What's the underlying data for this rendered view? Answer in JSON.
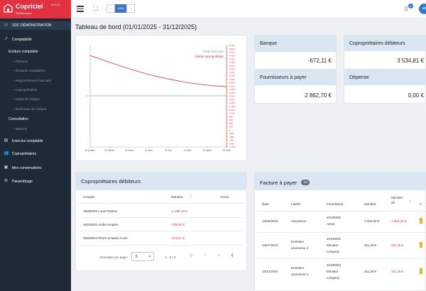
{
  "app": {
    "name": "Copriciel",
    "version": "v2.4.11",
    "subtitle": "Gestionnaire",
    "brand_color": "#e0323f"
  },
  "sidebar": {
    "company": "SDC DÉMONSTRATION",
    "comptabilite": "Comptabilité",
    "ecriture_title": "Écriture comptable",
    "ecriture_items": [
      "Factures",
      "Écritures comptables",
      "Rapprochement bancaire",
      "Copropriétaires",
      "Dépôt de chèque",
      "Bordereau de chèque"
    ],
    "consultation_title": "Consultation",
    "consultation_items": [
      "Balance"
    ],
    "exercice": "Exercice comptable",
    "coproprietaires": "Copropriétaires",
    "conversations": "Mes conversations",
    "parametrage": "Paramétrage"
  },
  "topbar": {
    "year": "2026",
    "prev": "←",
    "next": "→",
    "notif_count": "0",
    "avatar": "ab"
  },
  "page": {
    "title": "Tableau de bord  (01/01/2025 - 31/12/2025)"
  },
  "chart_data": {
    "type": "line",
    "x": [
      "01 janvier",
      "01 février",
      "01 mars",
      "01 avril",
      "01 mai",
      "01 juin",
      "01 juillet",
      "01 août"
    ],
    "series": [
      {
        "name": "Solde bancaire",
        "color": "#7aa6d6",
        "values": [
          0,
          0,
          0,
          0,
          0,
          0,
          0,
          0
        ]
      },
      {
        "name": "Solde copropriétaire",
        "color": "#e0323f",
        "values": [
          4400,
          4000,
          3620,
          3280,
          3020,
          2800,
          2650,
          2560
        ]
      }
    ],
    "left_axis": {
      "ticks": [
        "0,0"
      ]
    },
    "right_axis": {
      "ylim": [
        -1000,
        5000
      ],
      "ticks": [
        "5 000",
        "4 800",
        "4 600",
        "4 400",
        "4 200",
        "4 000",
        "3 800",
        "3 600",
        "3 400",
        "3 200",
        "3 000",
        "2 800",
        "2 600",
        "2 400",
        "2 200",
        "2 000",
        "1 800",
        "1 600",
        "1 400",
        "1 200",
        "1 000",
        "800",
        "600",
        "400",
        "200",
        "0",
        "-200",
        "-400",
        "-600",
        "-800",
        "-1 000"
      ]
    },
    "legend_position": "top-right"
  },
  "cards": [
    {
      "label": "Banque",
      "value": "-672,11 €"
    },
    {
      "label": "Copropriétaires débiteurs",
      "value": "3 534,81 €"
    },
    {
      "label": "Fournisseurs à payer",
      "value": "2 862,70 €"
    },
    {
      "label": "Dépense",
      "value": "0,00 €"
    }
  ],
  "debtors": {
    "title": "Copropriétaires débiteurs",
    "columns": [
      "Compte",
      "Montant",
      "Action"
    ],
    "sort_icon": "↑",
    "rows": [
      {
        "compte": "45000003 Louis Pasteur",
        "montant": "-1 185,40 €"
      },
      {
        "compte": "45000001 André Ampère",
        "montant": "-789,90 €"
      },
      {
        "compte": "45000004 Pierre et Marie Curie",
        "montant": "-576,87 €"
      }
    ],
    "pagination": {
      "label": "Résultats par page:",
      "per_page": "5",
      "range": "1 - 3 / 3"
    }
  },
  "invoices": {
    "title": "Facture à payer",
    "count": "10",
    "columns": [
      "Date",
      "Libellé",
      "Fournisseur",
      "Montant",
      "Montant dû",
      "A"
    ],
    "sort_icon": "↓",
    "rows": [
      {
        "date": "13/06/2024",
        "libelle": [
          "Assurance"
        ],
        "fournisseur": [
          "40100009",
          "Assur"
        ],
        "montant": "1 062,00 €",
        "du": "1 062,00 €"
      },
      {
        "date": "24/07/2024",
        "libelle": [
          "Entretien",
          "ascenseur 2"
        ],
        "fournisseur": [
          "40100003",
          "Elevator",
          "company"
        ],
        "montant": "311,28 €",
        "du": "311,28 €"
      },
      {
        "date": "12/12/2024",
        "libelle": [
          "Entretien",
          "ascenseur 2"
        ],
        "fournisseur": [
          "40100003",
          "Elevator",
          "company"
        ],
        "montant": "311,28 €",
        "du": "311,28 €"
      }
    ]
  }
}
